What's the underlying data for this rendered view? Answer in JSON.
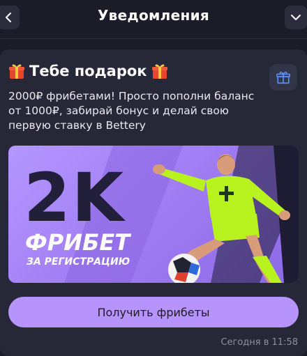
{
  "header": {
    "title": "Уведомления",
    "back_icon": "chevron-left-icon",
    "menu_icon": "chevron-down-icon"
  },
  "notification": {
    "title": "Тебе подарок",
    "title_emoji": "gift-emoji",
    "badge_icon": "gift-icon",
    "text": "2000₽ фрибетами! Просто пополни баланс от 1000₽, забирай бонус и делай свою первую ставку в Bettery",
    "banner": {
      "amount": "2K",
      "headline": "ФРИБЕТ",
      "subline": "ЗА РЕГИСТРАЦИЮ"
    },
    "button_label": "Получить фрибеты",
    "timestamp": "Сегодня в 11:58"
  },
  "colors": {
    "background": "#1b1c27",
    "card": "#262837",
    "accent": "#b694fb",
    "banner_purple": "#a584f7",
    "player_kit": "#b8f21f"
  }
}
